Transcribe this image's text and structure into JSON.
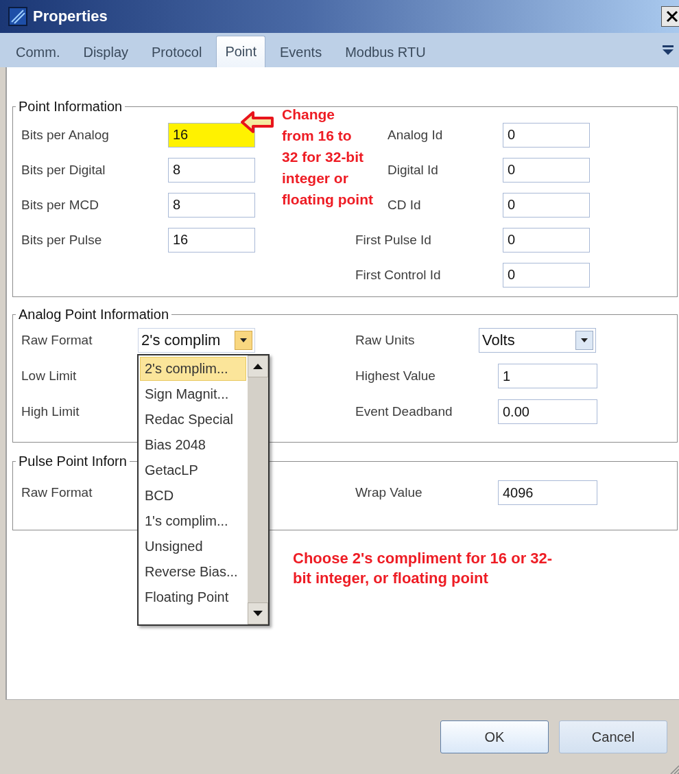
{
  "window": {
    "title": "Properties"
  },
  "tabs": [
    {
      "label": "Comm.",
      "selected": false
    },
    {
      "label": "Display",
      "selected": false
    },
    {
      "label": "Protocol",
      "selected": false
    },
    {
      "label": "Point",
      "selected": true
    },
    {
      "label": "Events",
      "selected": false
    },
    {
      "label": "Modbus RTU",
      "selected": false
    }
  ],
  "point_information": {
    "title": "Point Information",
    "left": [
      {
        "label": "Bits per Analog",
        "value": "16",
        "highlighted": true
      },
      {
        "label": "Bits per Digital",
        "value": "8",
        "highlighted": false
      },
      {
        "label": "Bits per MCD",
        "value": "8",
        "highlighted": false
      },
      {
        "label": "Bits per Pulse",
        "value": "16",
        "highlighted": false
      }
    ],
    "right": [
      {
        "label": "Analog Id",
        "value": "0"
      },
      {
        "label": "Digital Id",
        "value": "0"
      },
      {
        "label": "CD Id",
        "value": "0"
      },
      {
        "label": "First Pulse Id",
        "value": "0"
      },
      {
        "label": "First Control Id",
        "value": "0"
      }
    ],
    "annotation": "Change\nfrom 16 to\n32 for 32-bit\ninteger or\nfloating point"
  },
  "analog_point_information": {
    "title": "Analog Point Information",
    "left": [
      {
        "label": "Raw Format",
        "kind": "combo",
        "value": "2's complim",
        "open": true,
        "options": [
          {
            "label": "2's complim...",
            "selected": true
          },
          {
            "label": "Sign Magnit...",
            "selected": false
          },
          {
            "label": "Redac Special",
            "selected": false
          },
          {
            "label": "Bias 2048",
            "selected": false
          },
          {
            "label": "GetacLP",
            "selected": false
          },
          {
            "label": "BCD",
            "selected": false
          },
          {
            "label": "1's complim...",
            "selected": false
          },
          {
            "label": "Unsigned",
            "selected": false
          },
          {
            "label": "Reverse Bias...",
            "selected": false
          },
          {
            "label": "Floating Point",
            "selected": false
          }
        ]
      },
      {
        "label": "Low Limit",
        "kind": "label"
      },
      {
        "label": "High Limit",
        "kind": "label"
      }
    ],
    "right": [
      {
        "label": "Raw Units",
        "kind": "combo",
        "value": "Volts",
        "open": false
      },
      {
        "label": "Highest Value",
        "kind": "field",
        "value": "1"
      },
      {
        "label": "Event Deadband",
        "kind": "field",
        "value": "0.00"
      }
    ]
  },
  "pulse_point_information": {
    "title": "Pulse Point Inforn",
    "left": [
      {
        "label": "Raw Format",
        "kind": "label"
      }
    ],
    "right": [
      {
        "label": "Wrap Value",
        "kind": "field",
        "value": "4096"
      }
    ]
  },
  "note": "Choose 2's compliment for 16 or 32-\nbit integer, or floating point",
  "buttons": [
    {
      "label": "OK",
      "default": true
    },
    {
      "label": "Cancel",
      "default": false
    }
  ]
}
